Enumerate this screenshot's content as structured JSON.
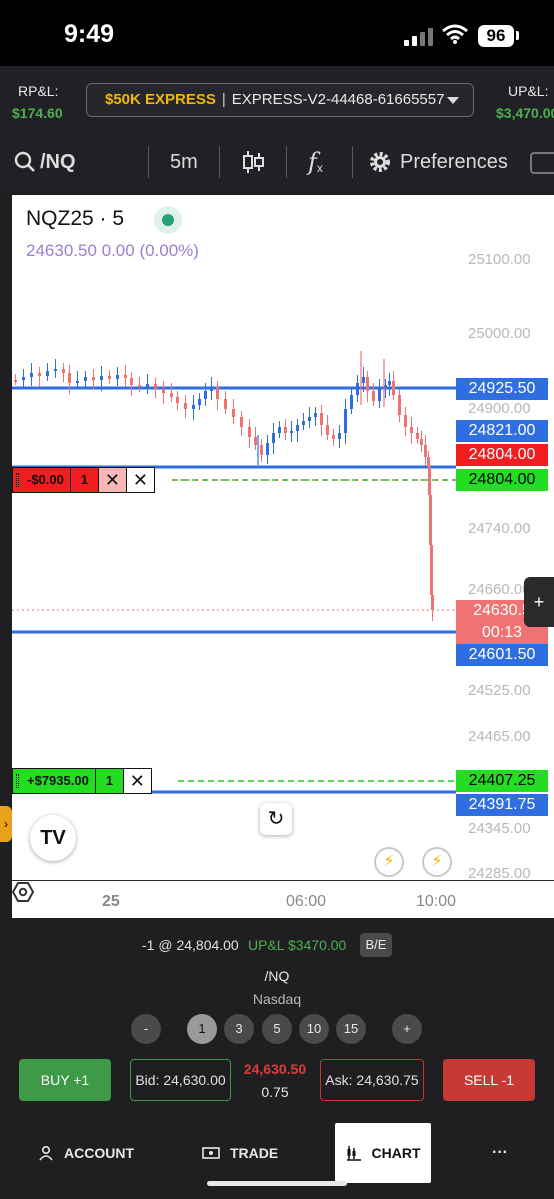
{
  "status_bar": {
    "time": "9:49",
    "battery": "96"
  },
  "account_bar": {
    "rpl_label": "RP&L:",
    "rpl_value": "$174.60",
    "plan": "$50K EXPRESS",
    "account_id": "EXPRESS-V2-44468-61665557",
    "upl_label": "UP&L:",
    "upl_value": "$3,470.00"
  },
  "toolbar": {
    "symbol": "/NQ",
    "interval": "5m",
    "indicator_symbol": "f",
    "preferences": "Preferences"
  },
  "chart": {
    "title": "NQZ25 · 5",
    "quote": "24630.50  0.00 (0.00%)",
    "price_labels": [
      {
        "text": "25100.00"
      },
      {
        "text": "25000.00"
      },
      {
        "text": "24900.00"
      },
      {
        "text": "24740.00"
      },
      {
        "text": "24660.00"
      },
      {
        "text": "24525.00"
      },
      {
        "text": "24465.00"
      },
      {
        "text": "24345.00"
      },
      {
        "text": "24285.00"
      }
    ],
    "tags": {
      "level_1": "24925.50",
      "level_2": "24821.00",
      "position_red": "24804.00",
      "position_green": "24804.00",
      "last_price": "24630.5",
      "countdown": "00:13",
      "level_3": "24601.50",
      "target": "24407.25",
      "level_4": "24391.75"
    },
    "position_order": {
      "pnl": "-$0.00",
      "qty": "1",
      "close": "✕",
      "cancel": "✕"
    },
    "target_order": {
      "pnl": "+$7935.00",
      "qty": "1",
      "close": "✕"
    },
    "x_labels": [
      "25",
      "06:00",
      "10:00"
    ],
    "tv_logo": "TV",
    "reset": "↻",
    "bolt": "⚡",
    "side_left": "›",
    "side_right": "+"
  },
  "position_summary": {
    "fill": "-1 @ 24,804.00",
    "upl": "UP&L $3470.00",
    "be": "B/E"
  },
  "instrument": {
    "symbol": "/NQ",
    "exchange": "Nasdaq"
  },
  "quantities": {
    "minus": "-",
    "values": [
      "1",
      "3",
      "5",
      "10",
      "15"
    ],
    "plus": "+"
  },
  "order_entry": {
    "buy": "BUY +1",
    "bid": "Bid: 24,630.00",
    "last": "24,630.50",
    "spread": "0.75",
    "ask": "Ask: 24,630.75",
    "sell": "SELL -1"
  },
  "nav": {
    "account": "ACCOUNT",
    "trade": "TRADE",
    "chart": "CHART",
    "more": "···"
  }
}
